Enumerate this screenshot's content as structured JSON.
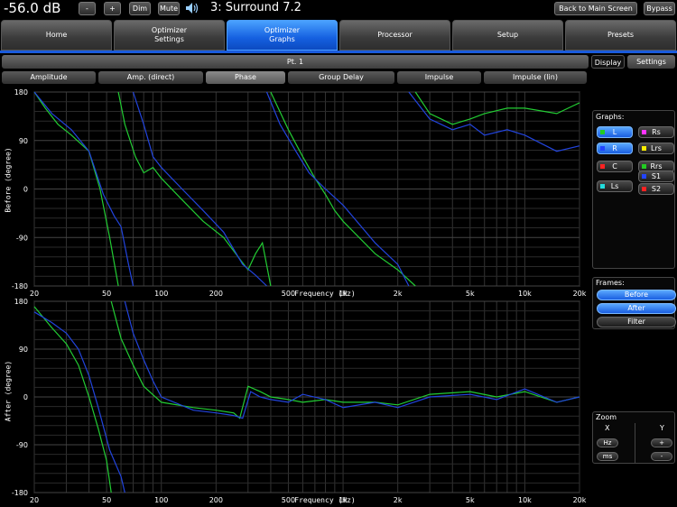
{
  "topbar": {
    "volume": "-56.0 dB",
    "minus_label": "-",
    "plus_label": "+",
    "dim_label": "Dim",
    "mute_label": "Mute",
    "preset": "3: Surround 7.2",
    "back_label": "Back to Main Screen",
    "bypass_label": "Bypass"
  },
  "tabs": [
    "Home",
    "Optimizer\nSettings",
    "Optimizer\nGraphs",
    "Processor",
    "Setup",
    "Presets"
  ],
  "section": {
    "title": "Pt. 1",
    "display_label": "Display",
    "settings_label": "Settings"
  },
  "subtabs": [
    "Amplitude",
    "Amp. (direct)",
    "Phase",
    "Group Delay",
    "Impulse",
    "Impulse (lin)"
  ],
  "plot_before": {
    "ylabel": "Before (degree)",
    "yticks": [
      "180",
      "90",
      "0",
      "-90",
      "-180"
    ],
    "xticks": [
      "20",
      "50",
      "100",
      "200",
      "500",
      "1k",
      "2k",
      "5k",
      "10k",
      "20k"
    ],
    "xlabel": "Frequency (Hz)"
  },
  "plot_after": {
    "ylabel": "After (degree)",
    "yticks": [
      "180",
      "90",
      "0",
      "-90",
      "-180"
    ],
    "xticks": [
      "20",
      "50",
      "100",
      "200",
      "500",
      "1k",
      "2k",
      "5k",
      "10k",
      "20k"
    ],
    "xlabel": "Frequency (Hz)"
  },
  "graphs": {
    "title": "Graphs:",
    "channels": [
      {
        "label": "L",
        "color": "#22cc22",
        "on": true
      },
      {
        "label": "Rs",
        "color": "#ff33ff",
        "on": false
      },
      {
        "label": "R",
        "color": "#2244ff",
        "on": true
      },
      {
        "label": "Lrs",
        "color": "#ffee00",
        "on": false
      },
      {
        "label": "C",
        "color": "#ff2222",
        "on": false
      },
      {
        "label": "Rrs",
        "color": "#22cc22",
        "on": false
      },
      {
        "label": "Ls",
        "color": "#22dddd",
        "on": false
      },
      {
        "label": "S1",
        "color": "#2244ff",
        "on": false
      },
      {
        "label": "S2",
        "color": "#ff2222",
        "on": false
      }
    ]
  },
  "frames": {
    "title": "Frames:",
    "before_label": "Before",
    "after_label": "After",
    "filter_label": "Filter"
  },
  "zoom": {
    "title": "Zoom",
    "x_label": "X",
    "y_label": "Y",
    "hz_label": "Hz",
    "ms_label": "ms",
    "plus_label": "+",
    "minus_label": "-"
  },
  "colors": {
    "accent": "#1a5bdc",
    "trace_left": "#22cc33",
    "trace_right": "#2244dd",
    "grid": "#3a3a3a"
  }
}
